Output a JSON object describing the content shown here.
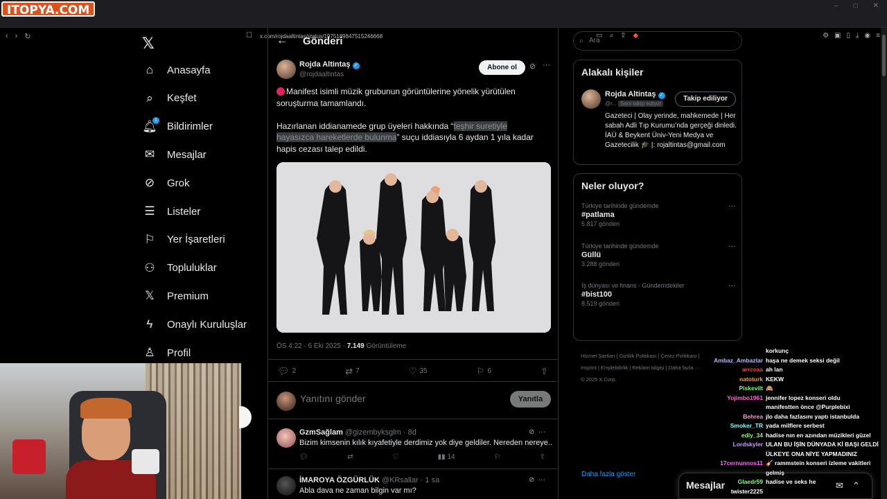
{
  "browser": {
    "site_logo": "ITOPYA.COM",
    "url": "x.com/rojdaaltintas/status/1975189847515246668"
  },
  "nav": {
    "items": [
      {
        "label": "Anasayfa",
        "icon": "home-icon"
      },
      {
        "label": "Keşfet",
        "icon": "search-icon"
      },
      {
        "label": "Bildirimler",
        "icon": "bell-icon",
        "badge": "1"
      },
      {
        "label": "Mesajlar",
        "icon": "mail-icon"
      },
      {
        "label": "Grok",
        "icon": "grok-icon"
      },
      {
        "label": "Listeler",
        "icon": "list-icon"
      },
      {
        "label": "Yer İşaretleri",
        "icon": "bookmark-icon"
      },
      {
        "label": "Topluluklar",
        "icon": "communities-icon"
      },
      {
        "label": "Premium",
        "icon": "x-icon"
      },
      {
        "label": "Onaylı Kuruluşlar",
        "icon": "lightning-icon"
      },
      {
        "label": "Profil",
        "icon": "person-icon"
      }
    ]
  },
  "post": {
    "header_title": "Gönderi",
    "author_name": "Rojda Altintaş",
    "author_handle": "@rojdaaltintas",
    "subscribe_label": "Abone ol",
    "para1": "Manifest isimli müzik grubunun görüntülerine yönelik yürütülen soruşturma tamamlandı.",
    "para2_before": "Hazırlanan iddianamede grup üyeleri hakkında  “",
    "para2_highlight": "teşhir suretiyle hayasızca hareketlerde bulunma",
    "para2_after": "” suçu iddiasıyla 6 aydan 1 yıla kadar hapis cezası talep edildi.",
    "time": "ÖS 4:22 · 6 Eki 2025 · ",
    "views_count": "7.149",
    "views_label": " Görüntüleme",
    "stats": {
      "replies": "2",
      "reposts": "7",
      "likes": "35",
      "bookmarks": "6"
    },
    "reply_placeholder": "Yanıtını gönder",
    "reply_button": "Yanıtla"
  },
  "comments": [
    {
      "name": "GzmSağlam",
      "handle": "@gizembyksglm · 8d",
      "text": "Bizim kimsenin kılık kıyafetiyle derdimiz yok diye geldiler. Nereden nereye..",
      "views": "14"
    },
    {
      "name": "İMAROYA ÖZGÜRLÜK",
      "handle": "@KRsallar · 1 sa",
      "text": "Abla dava ne zaman bilgin var mı?",
      "views": ""
    }
  ],
  "search": {
    "placeholder": "Ara"
  },
  "related": {
    "title": "Alakalı kişiler",
    "name": "Rojda Altintaş",
    "handle": "@r...",
    "follows_you": "Seni takip ediyor",
    "follow_label": "Takip ediliyor",
    "bio": "Gazeteci | Olay yerinde, mahkemede | Her sabah Adli Tıp Kurumu’nda gerçeği dinledi. İAÜ & Beykent Üniv-Yeni Medya ve Gazetecilik 🎓 |: rojaltintas@gmail.com"
  },
  "trends": {
    "title": "Neler oluyor?",
    "items": [
      {
        "category": "Türkiye tarihinde gündemde",
        "name": "#patlama",
        "count": "5.817 gönderi"
      },
      {
        "category": "Türkiye tarihinde gündemde",
        "name": "Güllü",
        "count": "3.288 gönderi"
      },
      {
        "category": "İş dünyası ve finans · Gündemdekiler",
        "name": "#bist100",
        "count": "8.519 gönderi"
      }
    ],
    "show_more": "Daha fazla göster"
  },
  "footer": {
    "line1": "Hizmet Şartları  |  Gizlilik Politikası  |  Çerez Politikası  |",
    "line2": "Imprint  |  Erişilebilirlik  |  Reklam bilgisi  |  Daha fazla ···",
    "line3": "© 2025 X Corp."
  },
  "messages_bar": {
    "title": "Mesajlar"
  },
  "chat": [
    {
      "user": "",
      "msg": "korkunç",
      "color": "#ffffff"
    },
    {
      "user": "Ambaz_Ambazlar",
      "msg": "haşa ne demek seksi değil",
      "color": "#b9b9ff"
    },
    {
      "user": "arrccaa",
      "msg": "ah lan",
      "color": "#ff4040"
    },
    {
      "user": "natoturk",
      "msg": "KEKW",
      "color": "#ff9a3c"
    },
    {
      "user": "Piskevilt",
      "msg": "🙈",
      "color": "#7dff7d"
    },
    {
      "user": "Yojimbo1961",
      "msg": "jennifer lopez konseri oldu",
      "color": "#ff6ad5"
    },
    {
      "user": "",
      "msg": "manifestten önce @Purplebixi",
      "color": "#ffffff"
    },
    {
      "user": "Behrea",
      "msg": "jlo daha fazlasını yaptı istanbulda",
      "color": "#ff9ad5"
    },
    {
      "user": "Smoker_TR",
      "msg": "yada milflere serbest",
      "color": "#7dffff"
    },
    {
      "user": "edly_34",
      "msg": "hadise nın en azından müzikleri güzel",
      "color": "#7dff7d"
    },
    {
      "user": "Lordskyler",
      "msg": "ULAN BU İŞİN DÜNYADA Kİ BAŞI GELDİ",
      "color": "#c9a0ff"
    },
    {
      "user": "",
      "msg": "ÜLKEYE ONA NİYE YAPMADINIZ",
      "color": "#ffffff"
    },
    {
      "user": "17cernunnos11",
      "msg": "🎸 rammstein konseri izleme vakitleri",
      "color": "#ff66ff"
    },
    {
      "user": "",
      "msg": "gelmiş",
      "color": "#ffffff"
    },
    {
      "user": "Glaedr59",
      "msg": "hadise ve seks he",
      "color": "#7dff7d"
    },
    {
      "user": "twister2225",
      "msg": "",
      "color": "#ffffff"
    }
  ]
}
